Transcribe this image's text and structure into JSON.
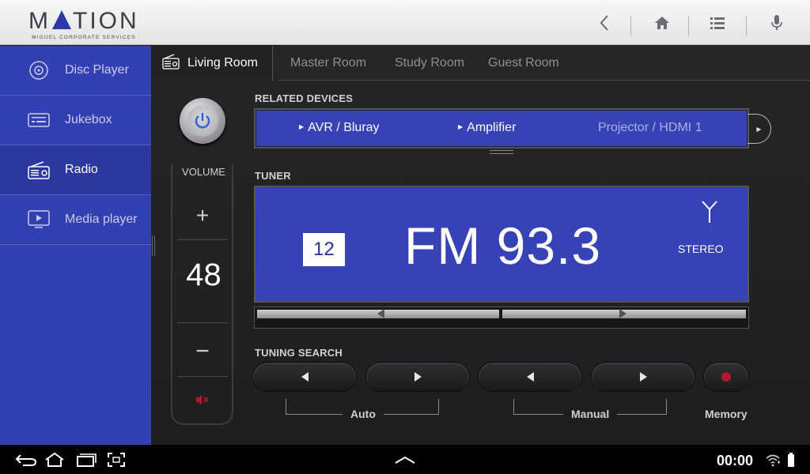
{
  "brand": {
    "name_left": "M",
    "name_right": "TION",
    "subtitle": "MIGUEL CORPORATE SERVICES"
  },
  "sidebar": {
    "items": [
      {
        "label": "Disc Player",
        "icon": "disc-icon"
      },
      {
        "label": "Jukebox",
        "icon": "jukebox-icon"
      },
      {
        "label": "Radio",
        "icon": "radio-icon",
        "active": true
      },
      {
        "label": "Media player",
        "icon": "media-player-icon"
      }
    ]
  },
  "tabs": [
    {
      "label": "Living Room",
      "active": true
    },
    {
      "label": "Master Room"
    },
    {
      "label": "Study Room"
    },
    {
      "label": "Guest Room"
    }
  ],
  "volume": {
    "label": "VOLUME",
    "plus": "+",
    "minus": "−",
    "value": "48"
  },
  "related_devices": {
    "label": "RELATED DEVICES",
    "items": [
      "AVR / Bluray",
      "Amplifier",
      "Projector / HDMI 1"
    ]
  },
  "tuner": {
    "label": "TUNER",
    "preset": "12",
    "frequency": "FM 93.3",
    "mode": "STEREO"
  },
  "tuning_search": {
    "label": "TUNING SEARCH",
    "auto_label": "Auto",
    "manual_label": "Manual",
    "memory_label": "Memory"
  },
  "status": {
    "time": "00:00"
  },
  "colors": {
    "accent": "#3340b2",
    "panel": "#3642b6",
    "record": "#b3182a"
  }
}
